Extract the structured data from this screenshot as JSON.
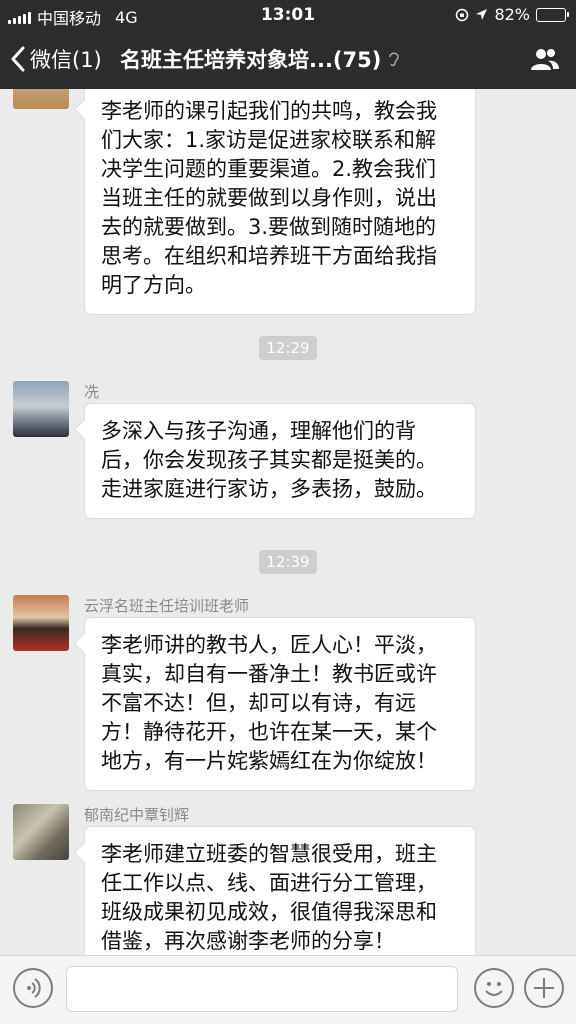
{
  "status_bar": {
    "carrier": "中国移动",
    "network": "4G",
    "time": "13:01",
    "battery": "82%",
    "battery_level": 0.82
  },
  "nav": {
    "back_label": "微信(1)",
    "title": "名班主任培养对象培...(75)",
    "bg_color": "#2c2c2e"
  },
  "messages": [
    {
      "sender": "",
      "lines": [
        "李老师的课引起我们的共鸣，教会我",
        "们大家：1.家访是促进家校联系和解",
        "决学生问题的重要渠道。2.教会我们",
        "当班主任的就要做到以身作则，说出",
        "去的就要做到。3.要做到随时随地的",
        "思考。在组织和培养班干方面给我指",
        "明了方向。"
      ]
    },
    {
      "time": "12:29"
    },
    {
      "sender": "冼",
      "lines": [
        "多深入与孩子沟通，理解他们的背",
        "后，你会发现孩子其实都是挺美的。",
        "走进家庭进行家访，多表扬，鼓励。"
      ]
    },
    {
      "time": "12:39"
    },
    {
      "sender": "云浮名班主任培训班老师",
      "lines": [
        "李老师讲的教书人，匠人心！平淡，",
        "真实，却自有一番净土！教书匠或许",
        "不富不达！但，却可以有诗，有远",
        "方！静待花开，也许在某一天，某个",
        "地方，有一片姹紫嫣红在为你绽放！"
      ]
    },
    {
      "sender": "郁南纪中覃钊辉",
      "lines": [
        "李老师建立班委的智慧很受用，班主",
        "任工作以点、线、面进行分工管理，",
        "班级成果初见成效，很值得我深思和",
        "借鉴，再次感谢李老师的分享！"
      ]
    }
  ],
  "input_bar": {
    "voice_icon": "voice-icon",
    "emoji_icon": "emoji-icon",
    "plus_icon": "plus-icon"
  }
}
